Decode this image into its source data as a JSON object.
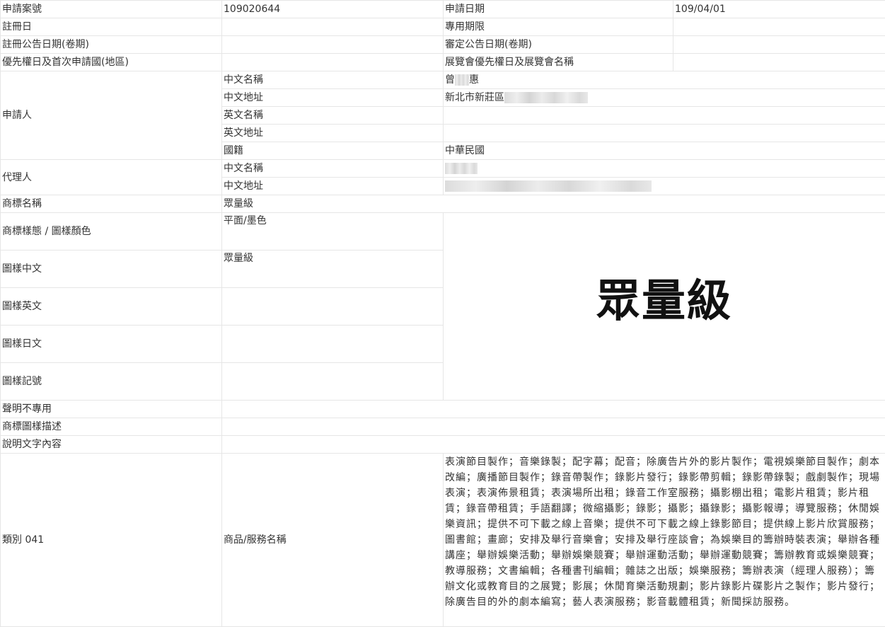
{
  "row1": {
    "app_no_label": "申請案號",
    "app_no": "109020644",
    "app_date_label": "申請日期",
    "app_date": "109/04/01"
  },
  "row2": {
    "reg_date_label": "註冊日",
    "term_label": "專用期限"
  },
  "row3": {
    "reg_pub_label": "註冊公告日期(卷期)",
    "exam_pub_label": "審定公告日期(卷期)"
  },
  "row4": {
    "priority_label": "優先權日及首次申請國(地區)",
    "expo_label": "展覽會優先權日及展覽會名稱"
  },
  "applicant": {
    "label": "申請人",
    "cn_name_label": "中文名稱",
    "cn_name_first": "曾",
    "cn_name_last": "惠",
    "cn_addr_label": "中文地址",
    "cn_addr": "新北市新莊區",
    "en_name_label": "英文名稱",
    "en_addr_label": "英文地址",
    "nationality_label": "國籍",
    "nationality": "中華民國"
  },
  "agent": {
    "label": "代理人",
    "cn_name_label": "中文名稱",
    "cn_addr_label": "中文地址"
  },
  "mark_name": {
    "label": "商標名稱",
    "value": "眾量級"
  },
  "mark_style": {
    "label": "商標樣態 / 圖樣顏色",
    "value": "平面/墨色"
  },
  "logo_text": "眾量級",
  "design_cn": {
    "label": "圖樣中文",
    "value": "眾量級"
  },
  "design_en": {
    "label": "圖樣英文"
  },
  "design_jp": {
    "label": "圖樣日文"
  },
  "design_symbol": {
    "label": "圖樣記號"
  },
  "disclaimer": {
    "label": "聲明不專用"
  },
  "design_desc": {
    "label": "商標圖樣描述"
  },
  "text_desc": {
    "label": "說明文字內容"
  },
  "class041": {
    "label": "類別 041",
    "goods_label": "商品/服務名稱",
    "goods": "表演節目製作；音樂錄製；配字幕；配音；除廣告片外的影片製作；電視娛樂節目製作；劇本改編；廣播節目製作；錄音帶製作；錄影片發行；錄影帶剪輯；錄影帶錄製；戲劇製作；現場表演；表演佈景租賃；表演場所出租；錄音工作室服務；攝影棚出租；電影片租賃；影片租賃；錄音帶租賃；手語翻譯；微縮攝影；錄影；攝影；攝錄影；攝影報導；導覽服務；休閒娛樂資訊；提供不可下載之線上音樂；提供不可下載之線上錄影節目；提供線上影片欣賞服務；圖書館；畫廊；安排及舉行音樂會；安排及舉行座談會；為娛樂目的籌辦時裝表演；舉辦各種講座；舉辦娛樂活動；舉辦娛樂競賽；舉辦運動活動；舉辦運動競賽；籌辦教育或娛樂競賽；教導服務；文書編輯；各種書刊編輯；雜誌之出版；娛樂服務；籌辦表演（經理人服務）；籌辦文化或教育目的之展覽；影展；休閒育樂活動規劃；影片錄影片碟影片之製作；影片發行；除廣告目的外的劇本編寫；藝人表演服務；影音載體租賃；新聞採訪服務。"
  }
}
